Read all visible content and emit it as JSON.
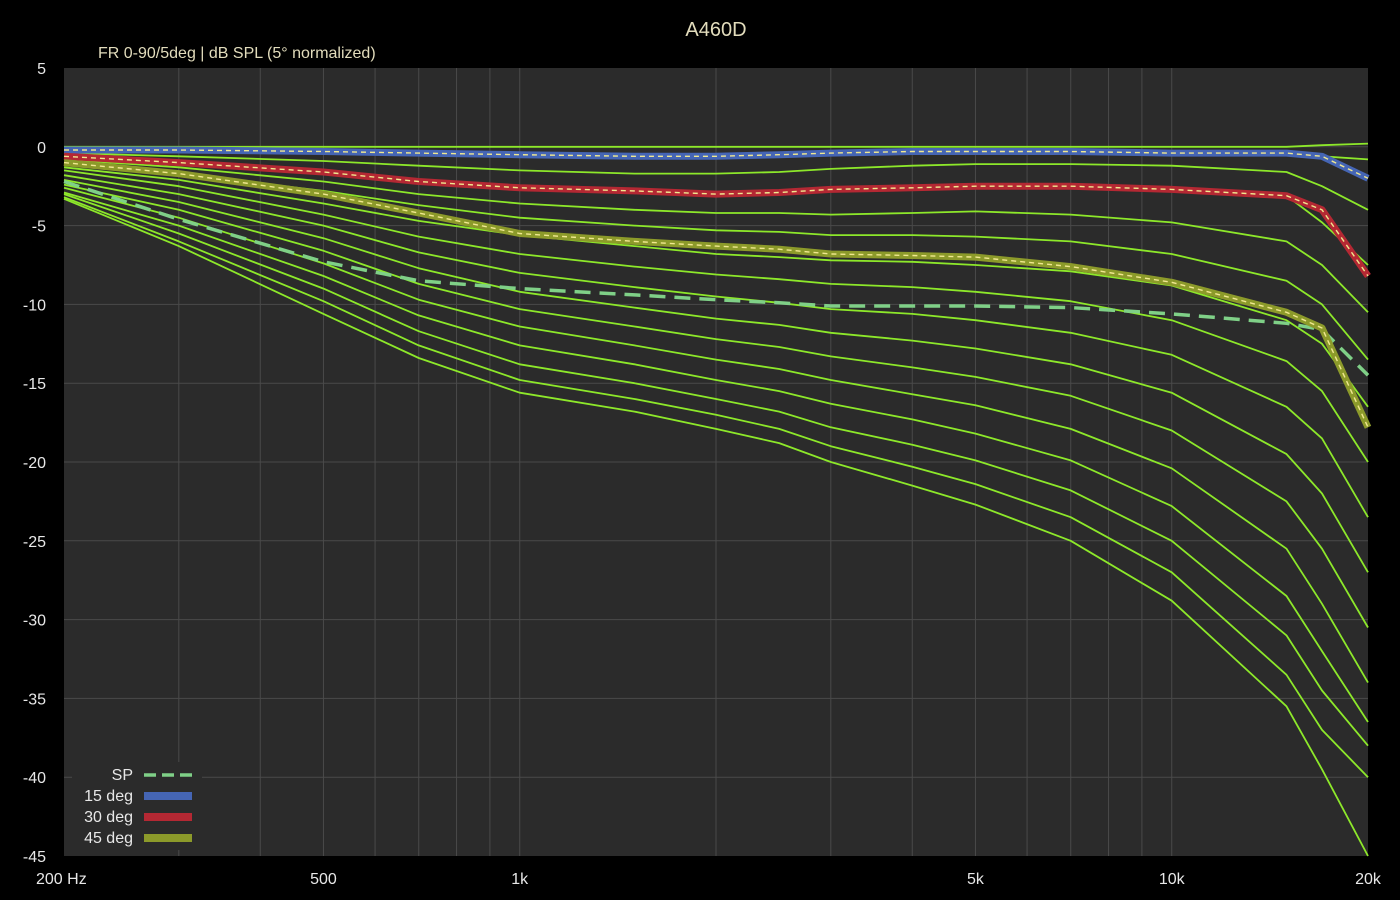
{
  "chart_data": {
    "type": "line",
    "title": "A460D",
    "subtitle": "FR 0-90/5deg | dB SPL (5° normalized)",
    "x_scale": "log",
    "xlim": [
      200,
      20000
    ],
    "ylim": [
      -45,
      5
    ],
    "grid": true,
    "legend_position": "bottom-left",
    "x_ticks": [
      {
        "value": 200,
        "label": "200 Hz"
      },
      {
        "value": 500,
        "label": "500"
      },
      {
        "value": 1000,
        "label": "1k"
      },
      {
        "value": 5000,
        "label": "5k"
      },
      {
        "value": 10000,
        "label": "10k"
      },
      {
        "value": 20000,
        "label": "20k"
      }
    ],
    "y_ticks": [
      5,
      0,
      -5,
      -10,
      -15,
      -20,
      -25,
      -30,
      -35,
      -40,
      -45
    ],
    "x": [
      200,
      300,
      500,
      700,
      1000,
      1500,
      2000,
      2500,
      3000,
      4000,
      5000,
      7000,
      10000,
      15000,
      17000,
      20000
    ],
    "colors": {
      "background": "#000000",
      "plot_area": "#2b2b2b",
      "grid": "#4a4a4a",
      "off_axis": "#8de82a",
      "sp": "#7fd087",
      "deg15": "#4565b4",
      "deg30": "#b42833",
      "deg45": "#8c9a2a"
    },
    "off_axis_curves": [
      [
        0,
        0,
        0,
        0,
        0,
        0,
        0,
        0,
        0,
        0,
        0,
        0,
        0,
        0,
        0.1,
        0.2
      ],
      [
        -0.2,
        -0.2,
        -0.3,
        -0.4,
        -0.5,
        -0.6,
        -0.6,
        -0.5,
        -0.4,
        -0.3,
        -0.3,
        -0.3,
        -0.4,
        -0.4,
        -0.6,
        -0.8
      ],
      [
        -0.4,
        -0.6,
        -0.9,
        -1.2,
        -1.5,
        -1.7,
        -1.7,
        -1.6,
        -1.4,
        -1.2,
        -1.1,
        -1.1,
        -1.2,
        -1.6,
        -2.5,
        -4.0
      ],
      [
        -0.6,
        -1.0,
        -1.6,
        -2.2,
        -2.6,
        -2.8,
        -3.0,
        -2.9,
        -2.7,
        -2.6,
        -2.5,
        -2.5,
        -2.7,
        -3.1,
        -4.8,
        -7.5
      ],
      [
        -0.8,
        -1.3,
        -2.2,
        -3.0,
        -3.6,
        -4.0,
        -4.2,
        -4.2,
        -4.3,
        -4.2,
        -4.1,
        -4.3,
        -4.8,
        -6.0,
        -7.5,
        -10.5
      ],
      [
        -1.0,
        -1.7,
        -2.8,
        -3.7,
        -4.5,
        -5.0,
        -5.3,
        -5.4,
        -5.6,
        -5.6,
        -5.7,
        -6.0,
        -6.8,
        -8.5,
        -10.0,
        -13.5
      ],
      [
        -1.3,
        -2.1,
        -3.6,
        -4.7,
        -5.6,
        -6.3,
        -6.8,
        -7.0,
        -7.2,
        -7.3,
        -7.5,
        -7.9,
        -8.8,
        -11.0,
        -12.5,
        -16.5
      ],
      [
        -1.5,
        -2.5,
        -4.3,
        -5.7,
        -6.8,
        -7.6,
        -8.1,
        -8.4,
        -8.7,
        -8.9,
        -9.2,
        -9.8,
        -11.0,
        -13.6,
        -15.5,
        -20.0
      ],
      [
        -1.8,
        -3.0,
        -5.0,
        -6.7,
        -8.0,
        -8.9,
        -9.5,
        -9.9,
        -10.3,
        -10.6,
        -11.0,
        -11.8,
        -13.2,
        -16.5,
        -18.5,
        -23.5
      ],
      [
        -2.1,
        -3.5,
        -5.8,
        -7.7,
        -9.2,
        -10.2,
        -10.9,
        -11.3,
        -11.8,
        -12.3,
        -12.8,
        -13.8,
        -15.6,
        -19.5,
        -22.0,
        -27.0
      ],
      [
        -2.4,
        -4.0,
        -6.6,
        -8.7,
        -10.3,
        -11.4,
        -12.2,
        -12.7,
        -13.3,
        -14.0,
        -14.6,
        -15.8,
        -18.0,
        -22.5,
        -25.5,
        -30.5
      ],
      [
        -2.6,
        -4.5,
        -7.4,
        -9.7,
        -11.4,
        -12.6,
        -13.5,
        -14.1,
        -14.8,
        -15.7,
        -16.4,
        -17.9,
        -20.4,
        -25.5,
        -29.0,
        -34.0
      ],
      [
        -2.9,
        -5.0,
        -8.2,
        -10.7,
        -12.6,
        -13.8,
        -14.8,
        -15.5,
        -16.3,
        -17.3,
        -18.2,
        -19.9,
        -22.8,
        -28.5,
        -32.0,
        -36.5
      ],
      [
        -3.0,
        -5.5,
        -9.0,
        -11.7,
        -13.8,
        -15.0,
        -16.0,
        -16.8,
        -17.8,
        -18.9,
        -19.9,
        -21.8,
        -25.0,
        -31.0,
        -34.5,
        -38.0
      ],
      [
        -3.2,
        -6.0,
        -9.8,
        -12.6,
        -14.8,
        -16.0,
        -17.0,
        -17.9,
        -19.0,
        -20.3,
        -21.4,
        -23.5,
        -27.0,
        -33.5,
        -37.0,
        -40.0
      ],
      [
        -3.3,
        -6.3,
        -10.6,
        -13.4,
        -15.6,
        -16.8,
        -17.9,
        -18.8,
        -20.0,
        -21.5,
        -22.7,
        -25.0,
        -28.8,
        -35.5,
        -39.5,
        -45.0
      ]
    ],
    "series": [
      {
        "name": "SP",
        "style": "dashed",
        "values": [
          -2.2,
          -4.6,
          -7.3,
          -8.5,
          -9.0,
          -9.4,
          -9.7,
          -9.9,
          -10.1,
          -10.1,
          -10.1,
          -10.2,
          -10.6,
          -11.2,
          -11.6,
          -14.5
        ]
      },
      {
        "name": "15 deg",
        "style": "highlight",
        "values": [
          -0.2,
          -0.2,
          -0.3,
          -0.4,
          -0.5,
          -0.6,
          -0.6,
          -0.5,
          -0.4,
          -0.3,
          -0.3,
          -0.3,
          -0.4,
          -0.4,
          -0.6,
          -2.0
        ]
      },
      {
        "name": "30 deg",
        "style": "highlight",
        "values": [
          -0.6,
          -1.0,
          -1.6,
          -2.2,
          -2.6,
          -2.8,
          -3.0,
          -2.9,
          -2.7,
          -2.6,
          -2.5,
          -2.5,
          -2.7,
          -3.1,
          -4.0,
          -8.2
        ]
      },
      {
        "name": "45 deg",
        "style": "highlight",
        "values": [
          -1.0,
          -1.7,
          -3.0,
          -4.2,
          -5.5,
          -6.0,
          -6.3,
          -6.5,
          -6.8,
          -6.9,
          -7.0,
          -7.6,
          -8.6,
          -10.5,
          -11.5,
          -17.8
        ]
      }
    ]
  }
}
